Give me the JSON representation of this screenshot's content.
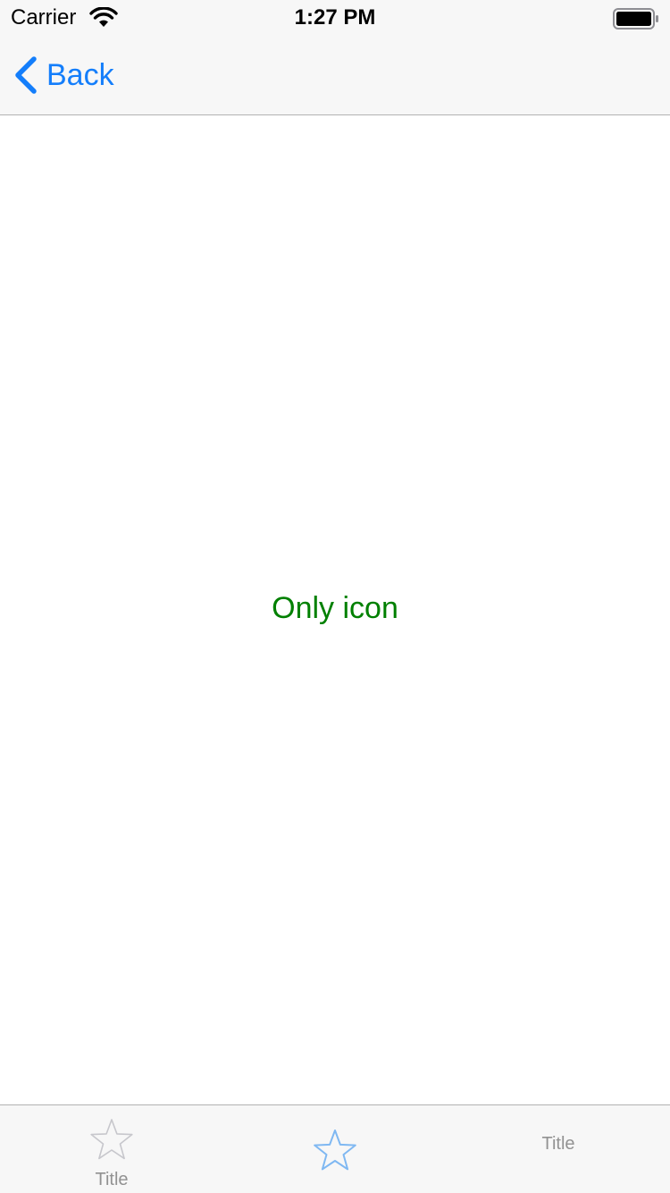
{
  "status_bar": {
    "carrier": "Carrier",
    "time": "1:27 PM"
  },
  "nav_bar": {
    "back_label": "Back"
  },
  "content": {
    "label": "Only icon"
  },
  "tab_bar": {
    "tabs": [
      {
        "icon": "star-outline-icon",
        "label": "Title",
        "selected": false
      },
      {
        "icon": "star-outline-icon",
        "label": "",
        "selected": true
      },
      {
        "icon": "",
        "label": "Title",
        "selected": false
      }
    ]
  },
  "colors": {
    "tint": "#147efb",
    "content_label": "#008000",
    "tab_inactive": "#929292",
    "bar_background": "#f7f7f7"
  }
}
